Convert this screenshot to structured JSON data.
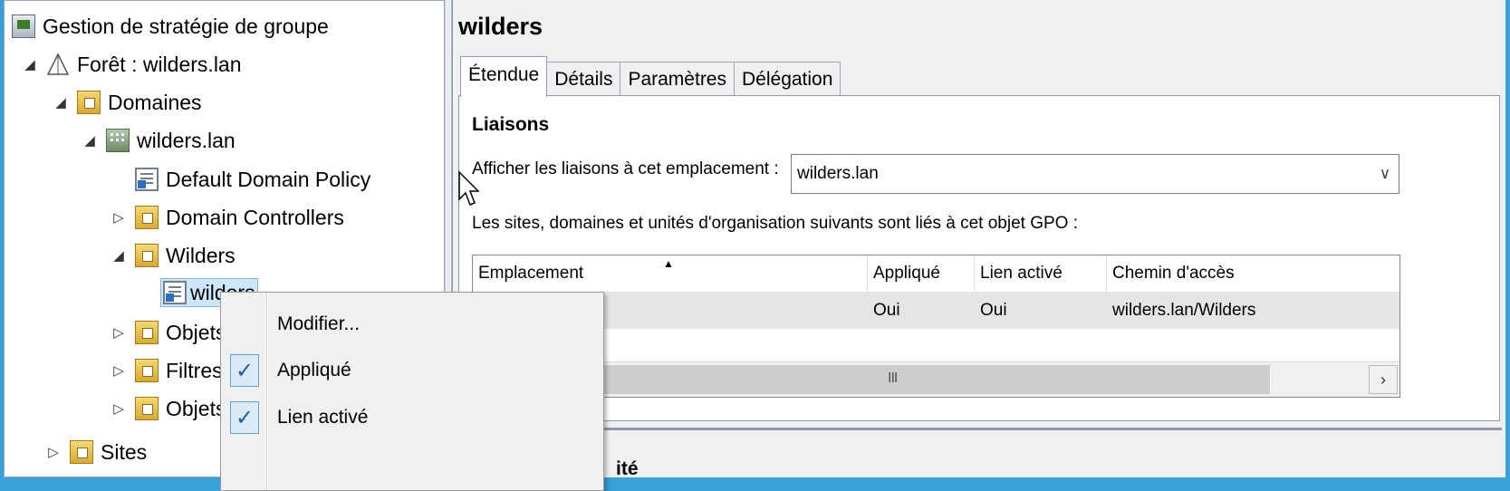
{
  "tree": {
    "root_label": "Gestion de stratégie de groupe",
    "forest_label": "Forêt : wilders.lan",
    "domains_label": "Domaines",
    "domain_label": "wilders.lan",
    "default_policy_label": "Default Domain Policy",
    "domain_controllers_label": "Domain Controllers",
    "ou_label": "Wilders",
    "gpo_link_label": "wilders",
    "gpo_objects_label": "Objets",
    "wmi_filters_label": "Filtres",
    "starter_gpo_label": "Objets",
    "sites_label": "Sites"
  },
  "context_menu": {
    "edit_label": "Modifier...",
    "enforced_label": "Appliqué",
    "enforced_checked": true,
    "link_enabled_label": "Lien activé",
    "link_enabled_checked": true,
    "check_glyph": "✓"
  },
  "detail": {
    "title": "wilders",
    "tabs": [
      "Étendue",
      "Détails",
      "Paramètres",
      "Délégation"
    ],
    "active_tab": "Étendue",
    "links_section": "Liaisons",
    "location_label": "Afficher les liaisons à cet emplacement :",
    "location_value": "wilders.lan",
    "linked_info": "Les sites, domaines et unités d'organisation suivants sont liés à cet objet GPO :",
    "columns": [
      "Emplacement",
      "Appliqué",
      "Lien activé",
      "Chemin d'accès"
    ],
    "rows": [
      {
        "location": "",
        "enforced": "Oui",
        "link_enabled": "Oui",
        "path": "wilders.lan/Wilders"
      }
    ],
    "scroll_grip": "III",
    "scroll_right": "›",
    "next_section_partial": "ité"
  },
  "colors": {
    "desktop": "#3aa0d8",
    "selection": "#cde6fb",
    "row_highlight": "#e5e5e5"
  }
}
